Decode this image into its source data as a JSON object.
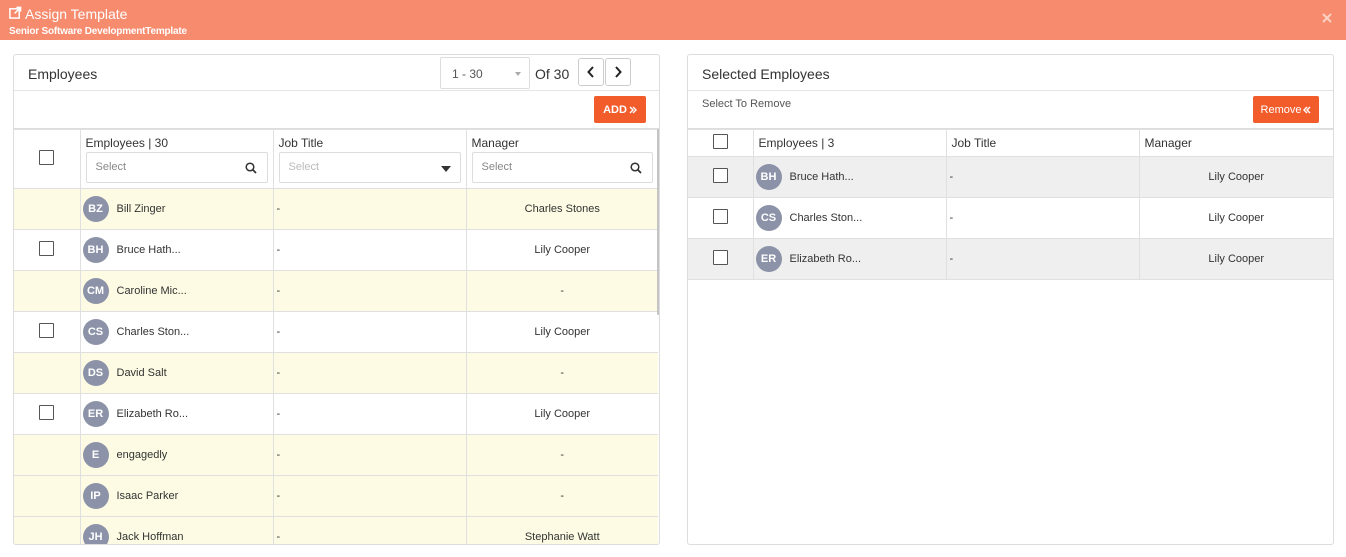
{
  "header": {
    "title": "Assign Template",
    "subtitle": "Senior Software DevelopmentTemplate",
    "icon": "share-icon",
    "close_icon": "close-icon",
    "background": "#f68b6e"
  },
  "left_panel": {
    "title": "Employees",
    "pager": {
      "range": "1 - 30",
      "of_label": "Of 30"
    },
    "add_label": "ADD",
    "add_icon": "double-chevron-right-icon",
    "columns": {
      "employees": "Employees | 30",
      "job_title": "Job Title",
      "manager": "Manager"
    },
    "filters": {
      "employees_placeholder": "Select",
      "job_title_placeholder": "Select",
      "manager_placeholder": "Select"
    },
    "rows": [
      {
        "initials": "BZ",
        "name": "Bill Zinger",
        "job_title": "-",
        "manager": "Charles Stones",
        "checkbox": false,
        "highlight": true
      },
      {
        "initials": "BH",
        "name": "Bruce Hath...",
        "job_title": "-",
        "manager": "Lily Cooper",
        "checkbox": true,
        "highlight": false
      },
      {
        "initials": "CM",
        "name": "Caroline Mic...",
        "job_title": "-",
        "manager": "-",
        "checkbox": false,
        "highlight": true
      },
      {
        "initials": "CS",
        "name": "Charles Ston...",
        "job_title": "-",
        "manager": "Lily Cooper",
        "checkbox": true,
        "highlight": false
      },
      {
        "initials": "DS",
        "name": "David Salt",
        "job_title": "-",
        "manager": "-",
        "checkbox": false,
        "highlight": true
      },
      {
        "initials": "ER",
        "name": "Elizabeth Ro...",
        "job_title": "-",
        "manager": "Lily Cooper",
        "checkbox": true,
        "highlight": false
      },
      {
        "initials": "E",
        "name": "engagedly",
        "job_title": "-",
        "manager": "-",
        "checkbox": false,
        "highlight": true
      },
      {
        "initials": "IP",
        "name": "Isaac Parker",
        "job_title": "-",
        "manager": "-",
        "checkbox": false,
        "highlight": true
      },
      {
        "initials": "JH",
        "name": "Jack Hoffman",
        "job_title": "-",
        "manager": "Stephanie Watt",
        "checkbox": false,
        "highlight": true
      }
    ]
  },
  "right_panel": {
    "title": "Selected Employees",
    "hint": "Select To Remove",
    "remove_label": "Remove",
    "remove_icon": "double-chevron-left-icon",
    "columns": {
      "employees": "Employees | 3",
      "job_title": "Job Title",
      "manager": "Manager"
    },
    "rows": [
      {
        "initials": "BH",
        "name": "Bruce Hath...",
        "job_title": "-",
        "manager": "Lily Cooper"
      },
      {
        "initials": "CS",
        "name": "Charles Ston...",
        "job_title": "-",
        "manager": "Lily Cooper"
      },
      {
        "initials": "ER",
        "name": "Elizabeth Ro...",
        "job_title": "-",
        "manager": "Lily Cooper"
      }
    ]
  },
  "colors": {
    "accent": "#f25c2b",
    "avatar": "#8c93a8",
    "row_highlight": "#fdfbe3",
    "selected_row": "#efefef"
  }
}
